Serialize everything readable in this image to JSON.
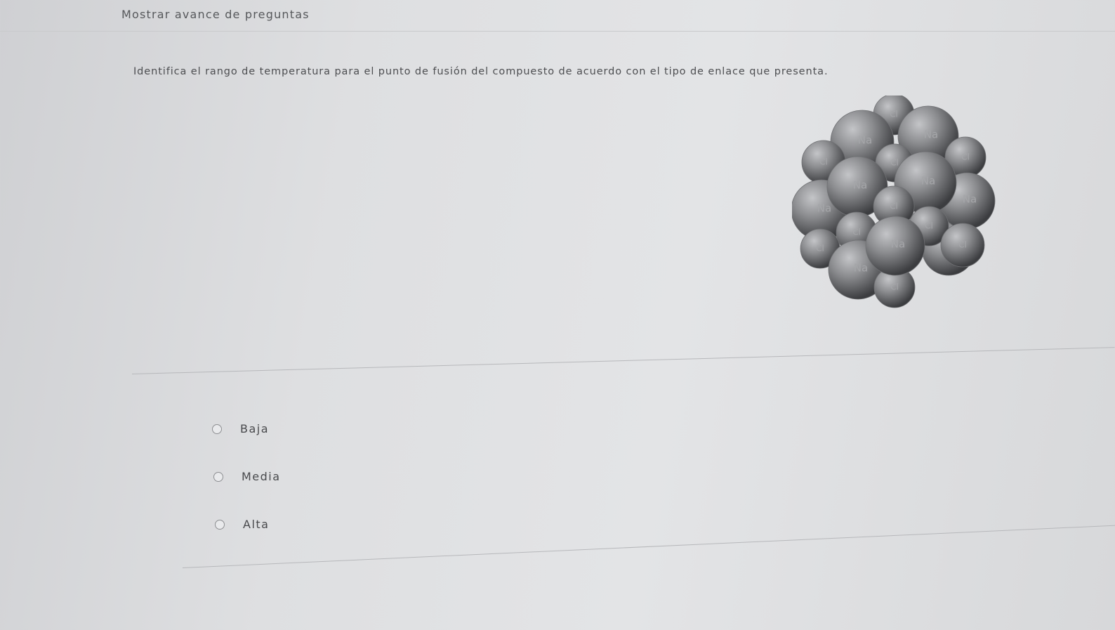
{
  "header": {
    "progress_link": "Mostrar avance de preguntas"
  },
  "question": {
    "text": "Identifica el rango de temperatura para el punto de fusión del compuesto de acuerdo con el tipo de enlace que presenta.",
    "image": {
      "icon": "nacl-crystal-lattice",
      "atom_labels": [
        "Na",
        "Cl",
        "Na",
        "Cl",
        "Na",
        "Cl",
        "Na",
        "Cl",
        "Na",
        "Cl",
        "Na",
        "Cl",
        "Na",
        "Cl",
        "Na",
        "Cl",
        "Na",
        "Cl"
      ]
    }
  },
  "options": [
    {
      "label": "Baja",
      "selected": false
    },
    {
      "label": "Media",
      "selected": false
    },
    {
      "label": "Alta",
      "selected": false
    }
  ],
  "colors": {
    "background": "#dedfe1",
    "text": "#4d4e51",
    "sphere": "#8a8b8e"
  }
}
